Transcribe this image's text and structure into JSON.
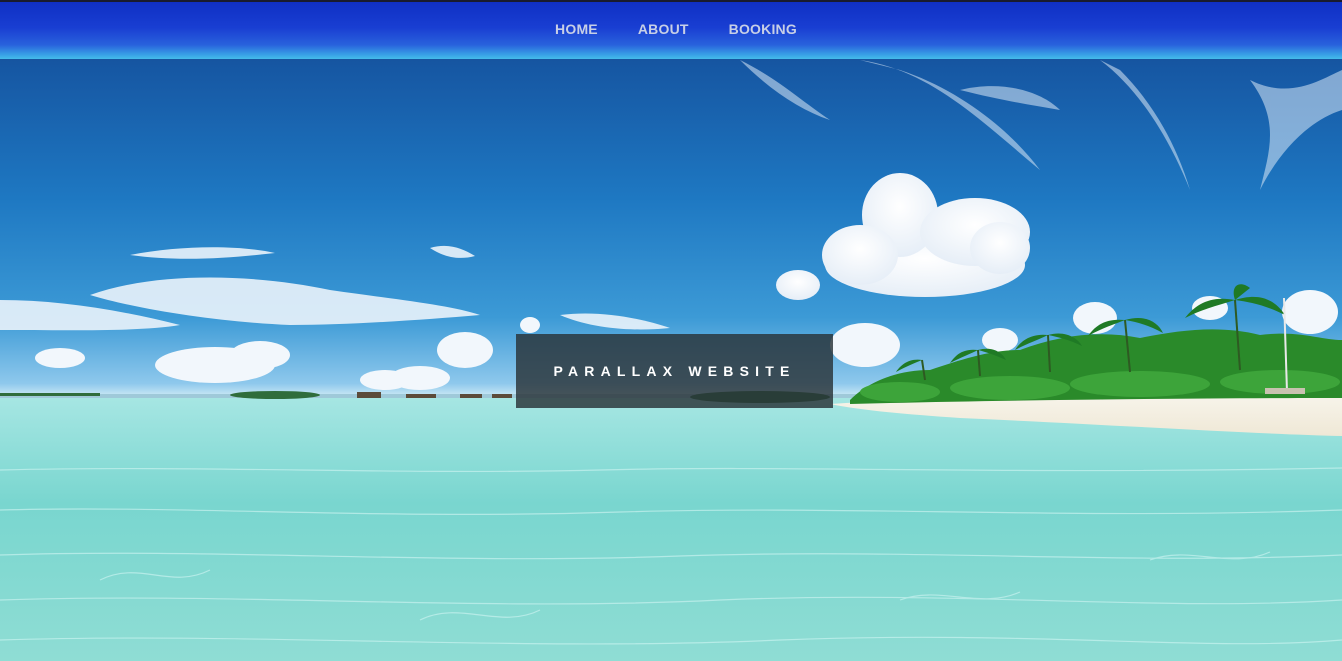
{
  "nav": {
    "items": [
      {
        "label": "HOME"
      },
      {
        "label": "ABOUT"
      },
      {
        "label": "BOOKING"
      }
    ]
  },
  "hero": {
    "caption": "PARALLAX WEBSITE",
    "image": "tropical-beach-scene"
  },
  "colors": {
    "nav_bar": "#1a3ed6",
    "nav_text": "#c7cfe6",
    "caption_bg": "#283237",
    "caption_text": "#ffffff"
  }
}
